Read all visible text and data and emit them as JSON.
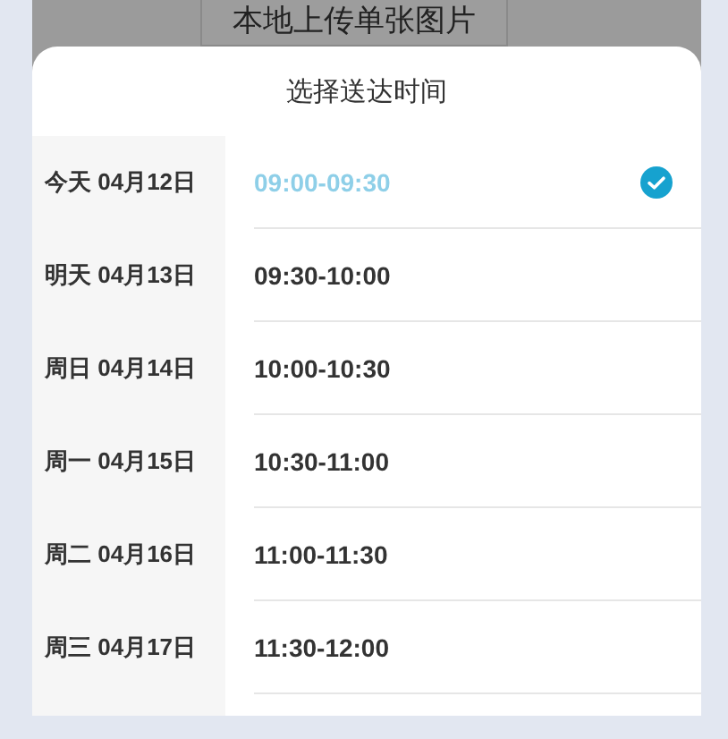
{
  "background_button": {
    "label": "本地上传单张图片"
  },
  "sheet": {
    "title": "选择送达时间"
  },
  "days": [
    {
      "label": "今天 04月12日"
    },
    {
      "label": "明天 04月13日"
    },
    {
      "label": "周日 04月14日"
    },
    {
      "label": "周一 04月15日"
    },
    {
      "label": "周二 04月16日"
    },
    {
      "label": "周三 04月17日"
    }
  ],
  "time_slots": [
    {
      "label": "09:00-09:30",
      "selected": true
    },
    {
      "label": "09:30-10:00",
      "selected": false
    },
    {
      "label": "10:00-10:30",
      "selected": false
    },
    {
      "label": "10:30-11:00",
      "selected": false
    },
    {
      "label": "11:00-11:30",
      "selected": false
    },
    {
      "label": "11:30-12:00",
      "selected": false
    }
  ]
}
